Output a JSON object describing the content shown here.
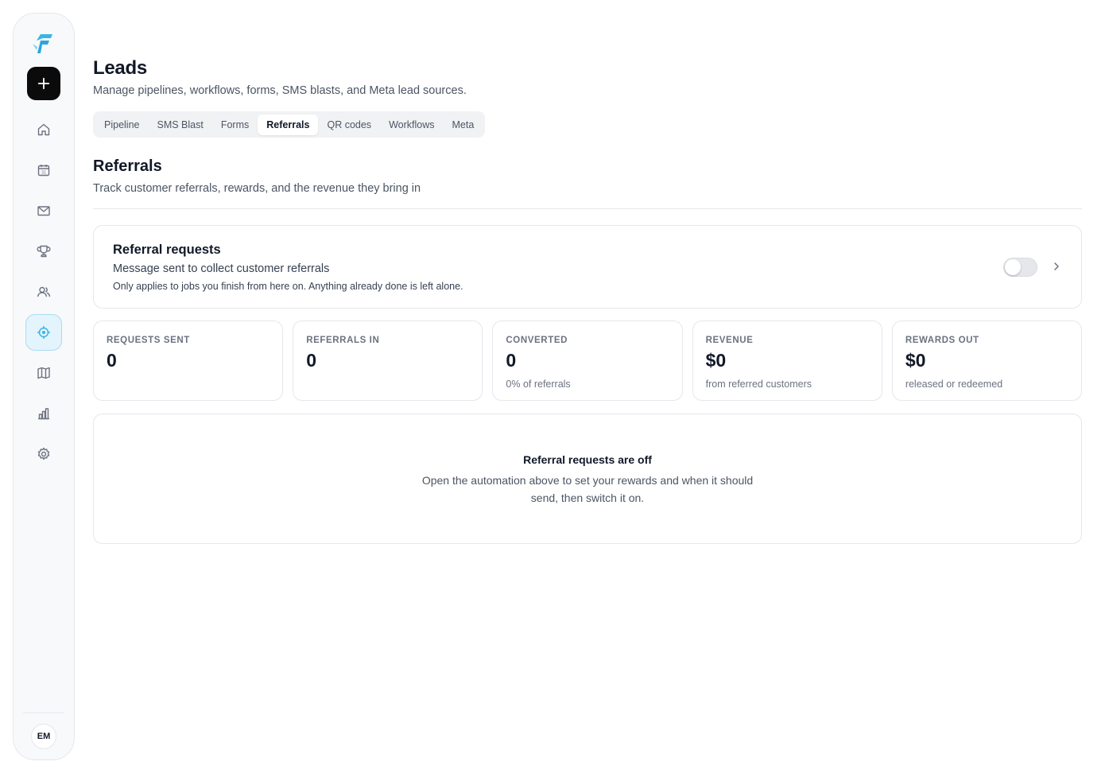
{
  "sidebar": {
    "logo_icon": "brand-logo-icon",
    "new_button_icon": "plus-icon",
    "nav": [
      {
        "icon": "home-icon"
      },
      {
        "icon": "calendar-icon",
        "badge": "31"
      },
      {
        "icon": "mail-icon"
      },
      {
        "icon": "trophy-icon"
      },
      {
        "icon": "users-icon"
      },
      {
        "icon": "crosshair-icon",
        "active": true
      },
      {
        "icon": "map-icon"
      },
      {
        "icon": "bar-chart-icon"
      },
      {
        "icon": "gear-icon"
      }
    ],
    "avatar": "EM"
  },
  "header": {
    "title": "Leads",
    "subtitle": "Manage pipelines, workflows, forms, SMS blasts, and Meta lead sources."
  },
  "tabs": [
    {
      "label": "Pipeline"
    },
    {
      "label": "SMS Blast"
    },
    {
      "label": "Forms"
    },
    {
      "label": "Referrals",
      "active": true
    },
    {
      "label": "QR codes"
    },
    {
      "label": "Workflows"
    },
    {
      "label": "Meta"
    }
  ],
  "section": {
    "title": "Referrals",
    "subtitle": "Track customer referrals, rewards, and the revenue they bring in"
  },
  "request_card": {
    "title": "Referral requests",
    "description": "Message sent to collect customer referrals",
    "note": "Only applies to jobs you finish from here on. Anything already done is left alone.",
    "enabled": false
  },
  "stats": [
    {
      "label": "REQUESTS SENT",
      "value": "0",
      "sub": ""
    },
    {
      "label": "REFERRALS IN",
      "value": "0",
      "sub": ""
    },
    {
      "label": "CONVERTED",
      "value": "0",
      "sub": "0% of referrals"
    },
    {
      "label": "REVENUE",
      "value": "$0",
      "sub": "from referred customers"
    },
    {
      "label": "REWARDS OUT",
      "value": "$0",
      "sub": "released or redeemed"
    }
  ],
  "empty_state": {
    "title": "Referral requests are off",
    "description": "Open the automation above to set your rewards and when it should send, then switch it on."
  },
  "colors": {
    "accent": "#3bb4e5",
    "active_nav_bg": "#e3f4fc",
    "icon_gray": "#6b7280"
  }
}
